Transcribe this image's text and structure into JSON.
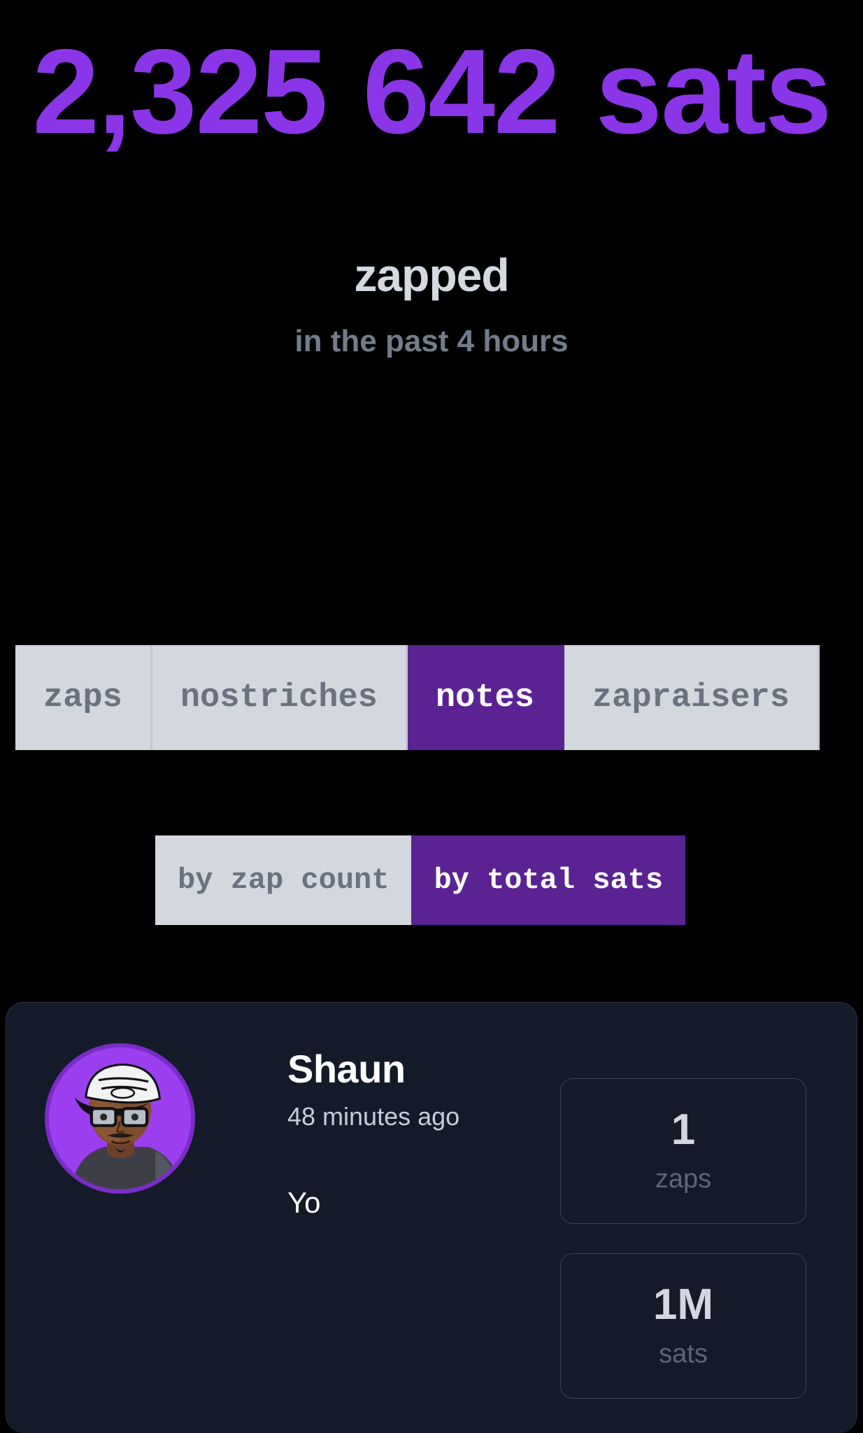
{
  "hero": {
    "amount": "2,325 642 sats",
    "verb": "zapped",
    "subtitle": "in the past 4 hours",
    "accent_color": "#8b35e8"
  },
  "tabs": {
    "items": [
      {
        "label": "zaps",
        "active": false
      },
      {
        "label": "nostriches",
        "active": false
      },
      {
        "label": "notes",
        "active": true
      },
      {
        "label": "zapraisers",
        "active": false
      }
    ],
    "active_bg": "#5a2293",
    "inactive_bg": "#d4d7dd"
  },
  "sort_toggle": {
    "options": [
      {
        "label": "by zap count",
        "active": false
      },
      {
        "label": "by total sats",
        "active": true
      }
    ]
  },
  "note_card": {
    "avatar_name": "avatar",
    "author": "Shaun",
    "timestamp": "48 minutes ago",
    "content": "Yo",
    "stats": [
      {
        "value": "1",
        "label": "zaps"
      },
      {
        "value": "1M",
        "label": "sats"
      }
    ],
    "card_bg": "#141a28"
  }
}
